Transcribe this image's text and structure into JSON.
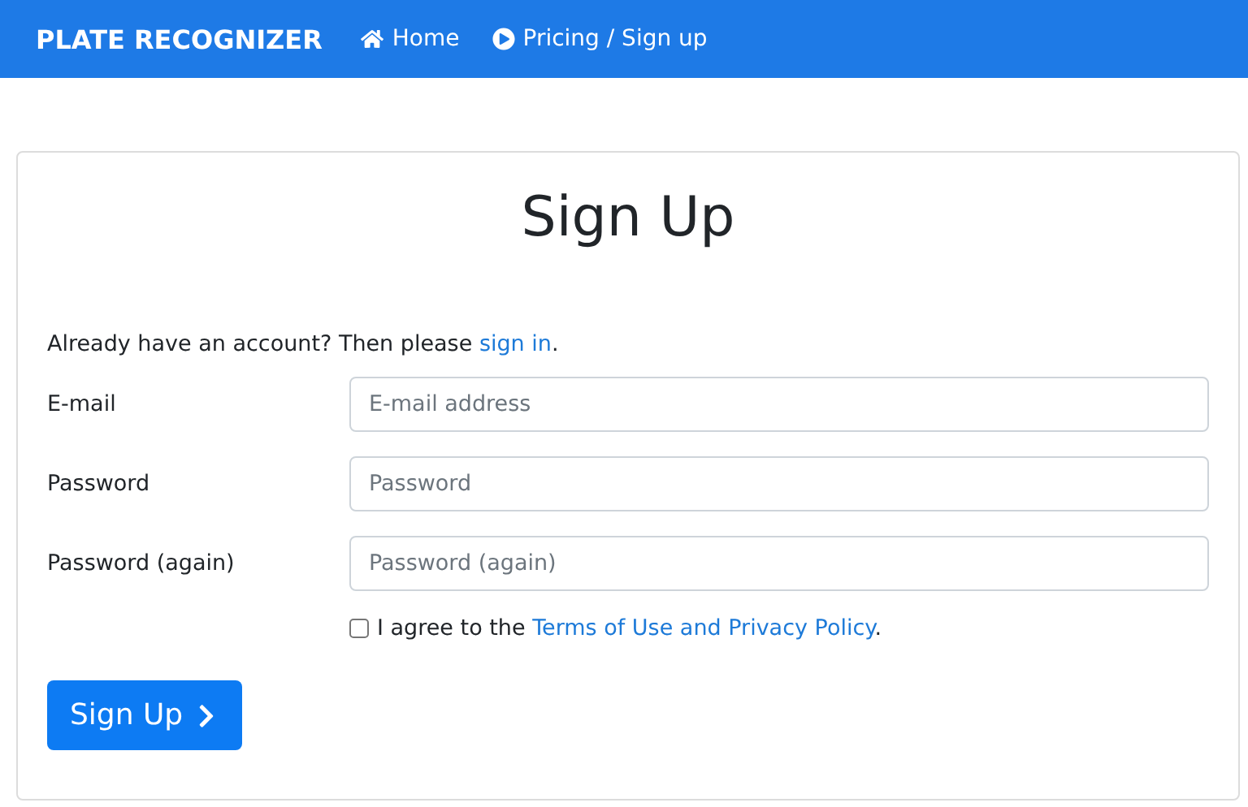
{
  "navbar": {
    "brand": "PLATE RECOGNIZER",
    "links": [
      {
        "kind": "home",
        "label": "Home"
      },
      {
        "kind": "play",
        "label": "Pricing / Sign up"
      }
    ]
  },
  "form": {
    "title": "Sign Up",
    "intro": {
      "before": "Already have an account? Then please ",
      "link": "sign in",
      "after": "."
    },
    "fields": [
      {
        "label": "E-mail",
        "placeholder": "E-mail address"
      },
      {
        "label": "Password",
        "placeholder": "Password"
      },
      {
        "label": "Password (again)",
        "placeholder": "Password (again)"
      }
    ],
    "agree": {
      "checked": false,
      "before": "I agree to the ",
      "link": "Terms of Use and Privacy Policy",
      "after": "."
    },
    "submit": "Sign Up"
  }
}
